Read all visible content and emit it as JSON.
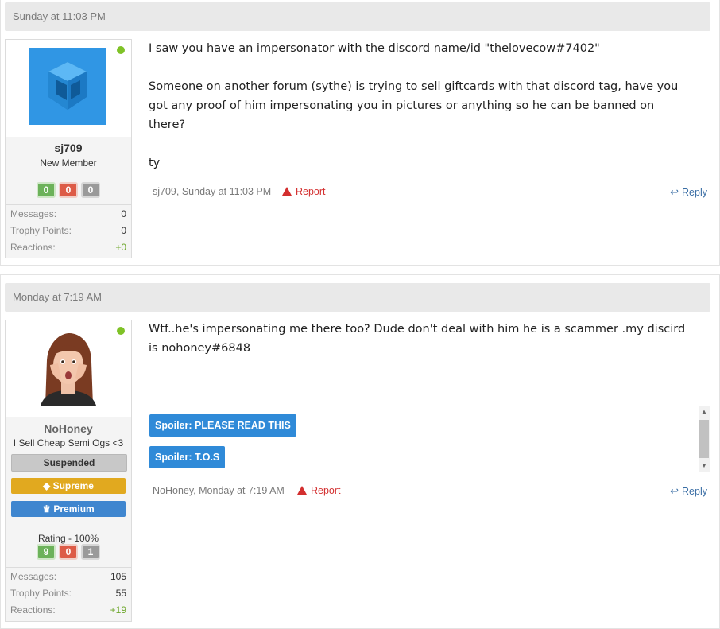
{
  "posts": [
    {
      "date": "Sunday at 11:03 PM",
      "user": {
        "name": "sj709",
        "title": "New Member",
        "rep": [
          "0",
          "0",
          "0"
        ],
        "stats": [
          {
            "label": "Messages:",
            "value": "0"
          },
          {
            "label": "Trophy Points:",
            "value": "0"
          },
          {
            "label": "Reactions:",
            "value": "+0"
          }
        ]
      },
      "message": "I saw you have an impersonator with the discord name/id \"thelovecow#7402\"\n\nSomeone on another forum (sythe) is trying to sell giftcards with that discord tag, have you\ngot any proof of him impersonating you in pictures or anything so he can be banned on\nthere?\n\nty",
      "footer": {
        "meta": "sj709, Sunday at 11:03 PM",
        "report": "Report",
        "reply": "Reply"
      }
    },
    {
      "date": "Monday at 7:19 AM",
      "user": {
        "name": "NoHoney",
        "title": "I Sell Cheap Semi Ogs <3",
        "badges": [
          "Suspended",
          "Supreme",
          "Premium"
        ],
        "rating": "Rating - 100%",
        "rep": [
          "9",
          "0",
          "1"
        ],
        "stats": [
          {
            "label": "Messages:",
            "value": "105"
          },
          {
            "label": "Trophy Points:",
            "value": "55"
          },
          {
            "label": "Reactions:",
            "value": "+19"
          }
        ]
      },
      "message": "Wtf..he's impersonating me there too? Dude don't deal with him he is a scammer .my discird\nis nohoney#6848",
      "spoilers": [
        "Spoiler: PLEASE READ THIS",
        "Spoiler: T.O.S"
      ],
      "footer": {
        "meta": "NoHoney, Monday at 7:19 AM",
        "report": "Report",
        "reply": "Reply"
      }
    }
  ],
  "colors": {
    "online": "#7fc227",
    "report": "#d32f2f",
    "reply": "#3a6ea5",
    "spoiler": "#2f8ad8"
  }
}
